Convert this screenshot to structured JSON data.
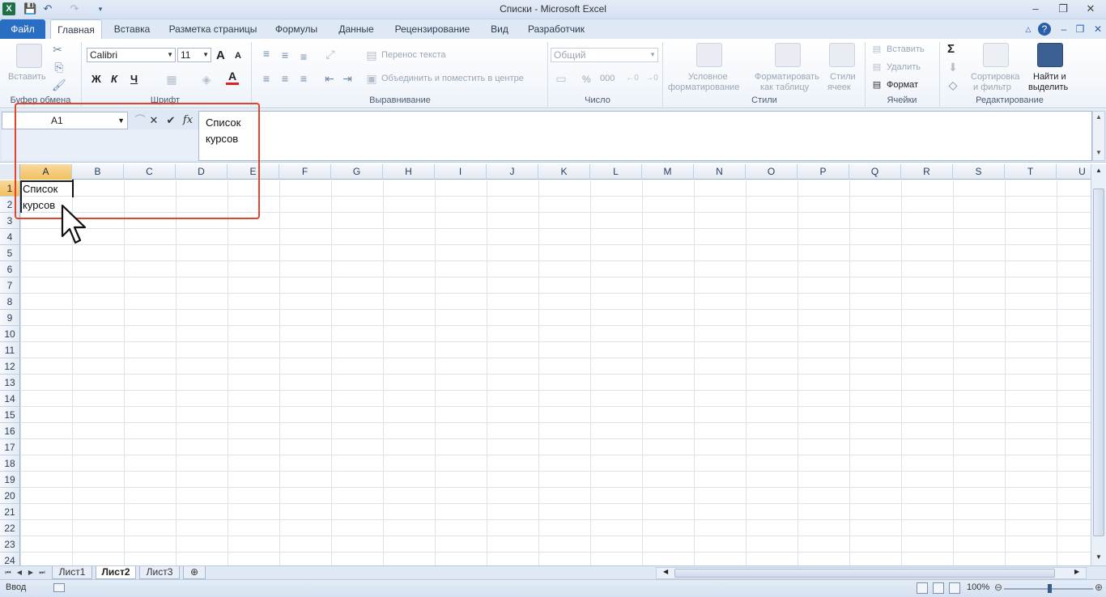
{
  "window": {
    "title": "Списки  -  Microsoft Excel",
    "logo": "X",
    "minimize": "–",
    "restore": "❐",
    "close": "✕"
  },
  "tabs": [
    {
      "label": "Файл",
      "kind": "file"
    },
    {
      "label": "Главная",
      "kind": "active"
    },
    {
      "label": "Вставка"
    },
    {
      "label": "Разметка страницы"
    },
    {
      "label": "Формулы"
    },
    {
      "label": "Данные"
    },
    {
      "label": "Рецензирование"
    },
    {
      "label": "Вид"
    },
    {
      "label": "Разработчик"
    }
  ],
  "ribbon": {
    "clipboard": {
      "paste": "Вставить",
      "label": "Буфер обмена"
    },
    "font": {
      "name": "Calibri",
      "size": "11",
      "bold": "Ж",
      "italic": "К",
      "underline": "Ч",
      "grow": "A",
      "shrink": "A",
      "label": "Шрифт"
    },
    "alignment": {
      "wrap": "Перенос текста",
      "merge": "Объединить и поместить в центре",
      "label": "Выравнивание"
    },
    "number": {
      "format": "Общий",
      "percent": "%",
      "thousands": "000",
      "label": "Число"
    },
    "styles": {
      "conditional_1": "Условное",
      "conditional_2": "форматирование",
      "table_1": "Форматировать",
      "table_2": "как таблицу",
      "cell_1": "Стили",
      "cell_2": "ячеек",
      "label": "Стили"
    },
    "cells": {
      "insert": "Вставить",
      "delete": "Удалить",
      "format": "Формат",
      "label": "Ячейки"
    },
    "editing": {
      "sigma": "Σ",
      "sort_1": "Сортировка",
      "sort_2": "и фильтр",
      "find_1": "Найти и",
      "find_2": "выделить",
      "label": "Редактирование"
    }
  },
  "formula_bar": {
    "name_box": "A1",
    "cancel": "✕",
    "enter": "✔",
    "fx": "fx",
    "line1": "Список",
    "line2": "курсов"
  },
  "grid": {
    "columns": [
      "A",
      "B",
      "C",
      "D",
      "E",
      "F",
      "G",
      "H",
      "I",
      "J",
      "K",
      "L",
      "M",
      "N",
      "O",
      "P",
      "Q",
      "R",
      "S",
      "T",
      "U"
    ],
    "selected_column": "A",
    "rows": [
      "1",
      "2",
      "3",
      "4",
      "5",
      "6",
      "7",
      "8",
      "9",
      "10",
      "11",
      "12",
      "13",
      "14",
      "15",
      "16",
      "17",
      "18",
      "19",
      "20",
      "21",
      "22",
      "23",
      "24"
    ],
    "selected_row": "1",
    "cell_a1_line1": "Список",
    "cell_a1_line2": "курсов"
  },
  "sheets": [
    {
      "label": "Лист1"
    },
    {
      "label": "Лист2",
      "active": true
    },
    {
      "label": "Лист3"
    }
  ],
  "status": {
    "mode": "Ввод",
    "zoom": "100%"
  },
  "colors": {
    "highlight": "#e0452e",
    "file_tab": "#2a6ec3",
    "selected_header": "#f1c15f"
  }
}
